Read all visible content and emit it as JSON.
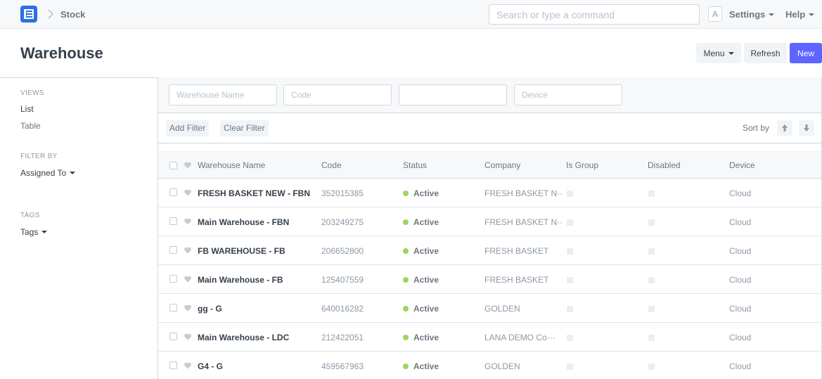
{
  "navbar": {
    "breadcrumb": "Stock",
    "search_placeholder": "Search or type a command",
    "avatar_letter": "A",
    "settings_label": "Settings",
    "help_label": "Help"
  },
  "page": {
    "title": "Warehouse",
    "menu_label": "Menu",
    "refresh_label": "Refresh",
    "new_label": "New"
  },
  "sidebar": {
    "views_label": "VIEWS",
    "views": [
      "List",
      "Table"
    ],
    "filter_by_label": "FILTER BY",
    "assigned_to": "Assigned To",
    "tags_label": "TAGS",
    "tags": "Tags"
  },
  "filters": {
    "warehouse_name_placeholder": "Warehouse Name",
    "code_placeholder": "Code",
    "blank_placeholder": "",
    "device_placeholder": "Device",
    "add_filter": "Add Filter",
    "clear_filter": "Clear Filter",
    "sort_by": "Sort by"
  },
  "list": {
    "columns": [
      "Warehouse Name",
      "Code",
      "Status",
      "Company",
      "Is Group",
      "Disabled",
      "Device"
    ],
    "rows": [
      {
        "name": "FRESH BASKET NEW - FBN",
        "code": "352015385",
        "status": "Active",
        "company": "FRESH BASKET N···",
        "device": "Cloud"
      },
      {
        "name": "Main Warehouse - FBN",
        "code": "203249275",
        "status": "Active",
        "company": "FRESH BASKET N···",
        "device": "Cloud"
      },
      {
        "name": "FB WAREHOUSE - FB",
        "code": "206652800",
        "status": "Active",
        "company": "FRESH BASKET",
        "device": "Cloud"
      },
      {
        "name": "Main Warehouse - FB",
        "code": "125407559",
        "status": "Active",
        "company": "FRESH BASKET",
        "device": "Cloud"
      },
      {
        "name": "gg - G",
        "code": "640016282",
        "status": "Active",
        "company": "GOLDEN",
        "device": "Cloud"
      },
      {
        "name": "Main Warehouse - LDC",
        "code": "212422051",
        "status": "Active",
        "company": "LANA DEMO Co···",
        "device": "Cloud"
      },
      {
        "name": "G4 - G",
        "code": "459567963",
        "status": "Active",
        "company": "GOLDEN",
        "device": "Cloud"
      }
    ]
  },
  "colors": {
    "primary": "#5e64ff",
    "logo": "#2c6fe8",
    "active_dot": "#98d85b"
  }
}
